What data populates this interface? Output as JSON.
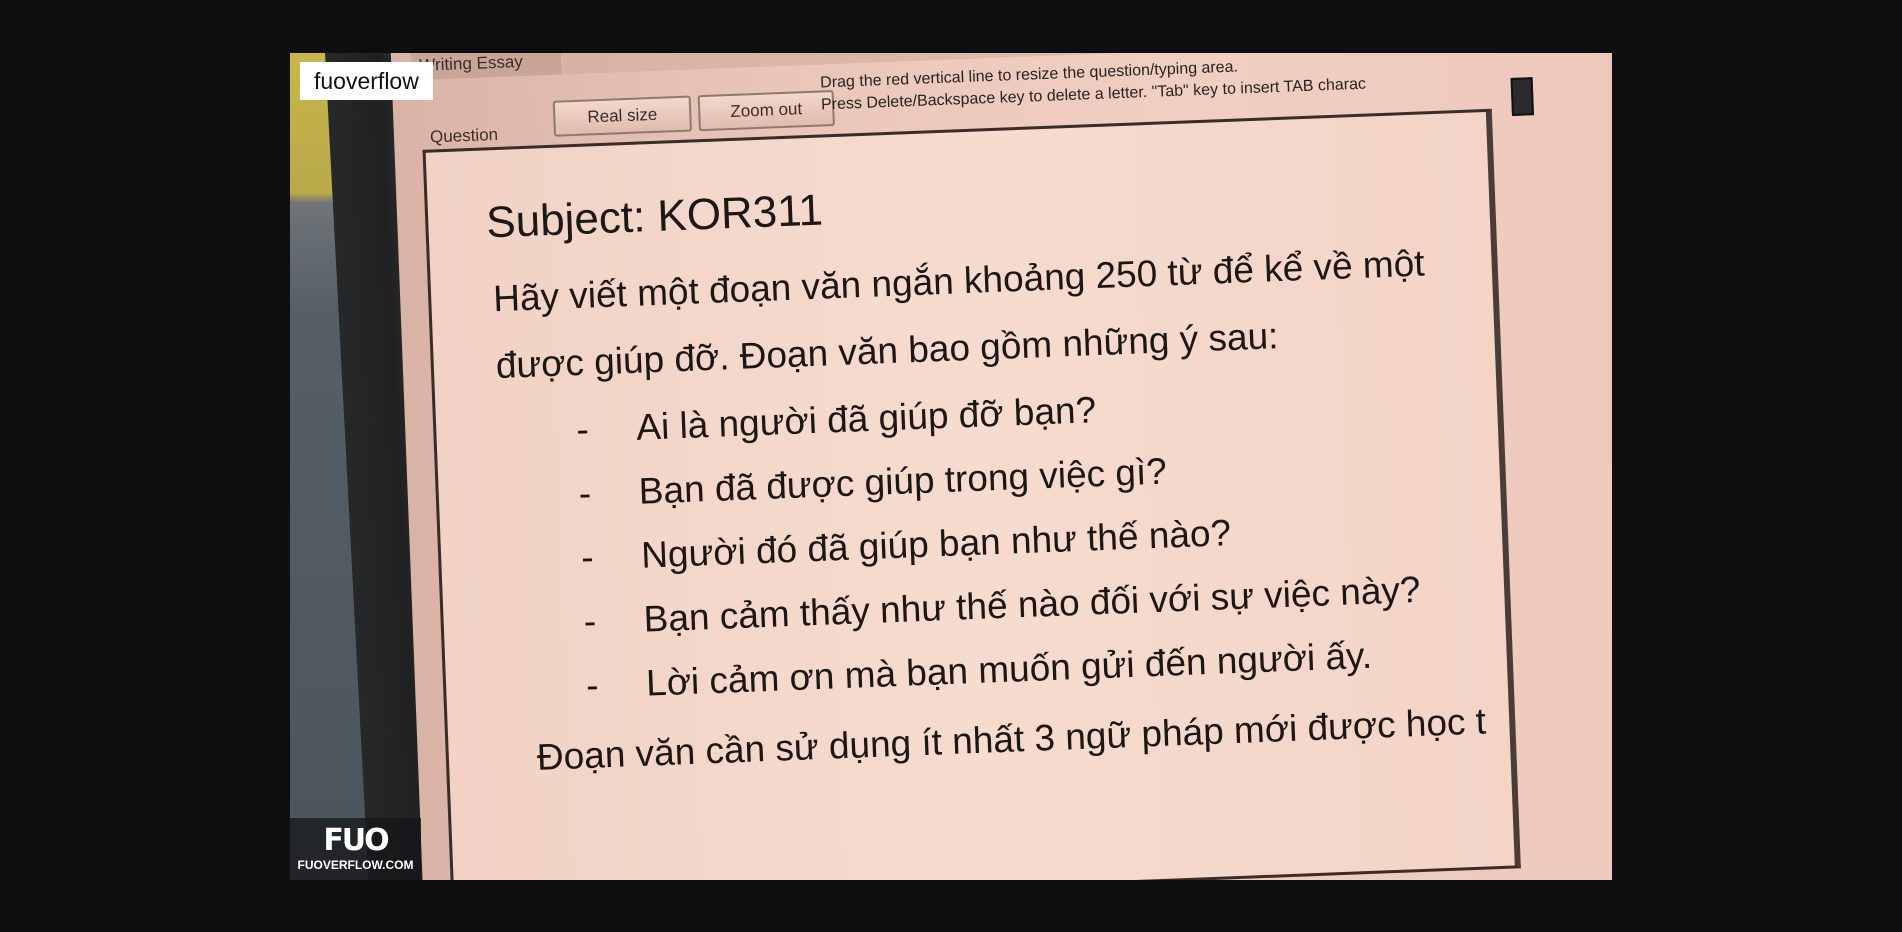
{
  "window": {
    "title": "Writing Essay"
  },
  "toolbar": {
    "question_label": "Question",
    "real_size_label": "Real size",
    "zoom_out_label": "Zoom out",
    "hint_line1": "Drag the red vertical line to resize the question/typing area.",
    "hint_line2": "Press Delete/Backspace key to delete a letter. \"Tab\" key to insert TAB charac"
  },
  "question": {
    "subject": "Subject: KOR311",
    "paragraph_line1": "Hãy viết một đoạn văn ngắn khoảng 250 từ để kể về một",
    "paragraph_line2": "được giúp đỡ. Đoạn văn bao gồm những ý sau:",
    "bullets": [
      "Ai là người đã giúp đỡ bạn?",
      "Bạn đã được giúp trong việc gì?",
      "Người đó đã giúp bạn như thế nào?",
      "Bạn cảm thấy như thế nào đối với sự việc này?",
      "Lời cảm ơn mà bạn muốn gửi đến người ấy."
    ],
    "bullet_marker": "-",
    "closing_line": "Đoạn văn cần sử dụng ít nhất 3 ngữ pháp mới được học t"
  },
  "overlay": {
    "watermark_text": "fuoverflow",
    "logo_mark": "FUO",
    "logo_site": "FUOVERFLOW.COM"
  },
  "colors": {
    "page_background": "#0e0f10",
    "screen_background": "#f0cfc2",
    "text": "#1c1614"
  }
}
